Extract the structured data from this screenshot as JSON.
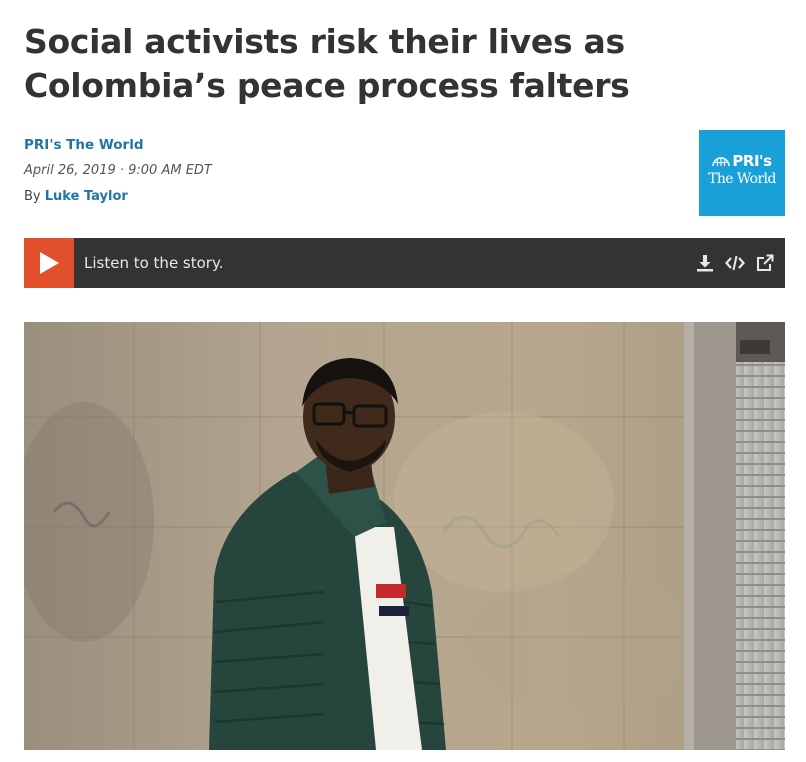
{
  "article": {
    "headline_line1": "Social activists risk their lives as",
    "headline_line2": "Colombia’s peace process falters",
    "source": "PRI's The World",
    "date": "April 26, 2019 · 9:00 AM EDT",
    "byline_prefix": "By",
    "author": "Luke Taylor"
  },
  "logo": {
    "line1": "PRI's",
    "line2": "The World",
    "background": "#1aa0d9"
  },
  "player": {
    "label": "Listen to the story.",
    "play_icon": "play-icon",
    "actions": [
      "download-icon",
      "embed-code-icon",
      "external-link-icon"
    ],
    "accent": "#e1502a",
    "bar_color": "#333333"
  },
  "colors": {
    "headline": "#333333",
    "link": "#1f75a4"
  }
}
